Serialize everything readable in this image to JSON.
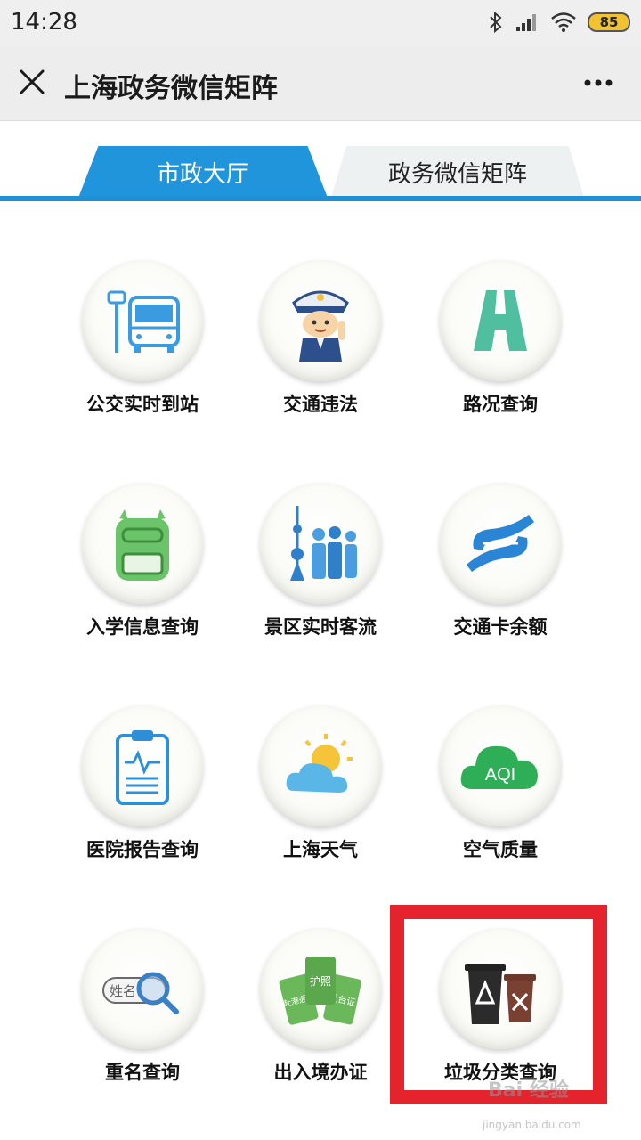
{
  "status_bar": {
    "time": "14:28",
    "battery": "85"
  },
  "app_bar": {
    "title": "上海政务微信矩阵"
  },
  "tabs": [
    {
      "label": "市政大厅",
      "active": true
    },
    {
      "label": "政务微信矩阵",
      "active": false
    }
  ],
  "services": [
    {
      "label": "公交实时到站",
      "icon": "bus-stop-icon"
    },
    {
      "label": "交通违法",
      "icon": "traffic-police-icon"
    },
    {
      "label": "路况查询",
      "icon": "road-icon"
    },
    {
      "label": "入学信息查询",
      "icon": "school-bag-icon"
    },
    {
      "label": "景区实时客流",
      "icon": "tourist-crowd-icon"
    },
    {
      "label": "交通卡余额",
      "icon": "transport-card-icon"
    },
    {
      "label": "医院报告查询",
      "icon": "medical-report-icon"
    },
    {
      "label": "上海天气",
      "icon": "weather-icon"
    },
    {
      "label": "空气质量",
      "icon": "air-quality-icon",
      "badge": "AQI"
    },
    {
      "label": "重名查询",
      "icon": "name-search-icon",
      "badge": "姓名"
    },
    {
      "label": "出入境办证",
      "icon": "passport-icon",
      "cards": [
        "赴港通证",
        "护照",
        "赴台证"
      ]
    },
    {
      "label": "垃圾分类查询",
      "icon": "trash-bin-icon"
    }
  ],
  "watermark": {
    "text": "Bai 经验",
    "url": "jingyan.baidu.com"
  },
  "colors": {
    "accent": "#2195dc",
    "highlight": "#e5232d"
  }
}
